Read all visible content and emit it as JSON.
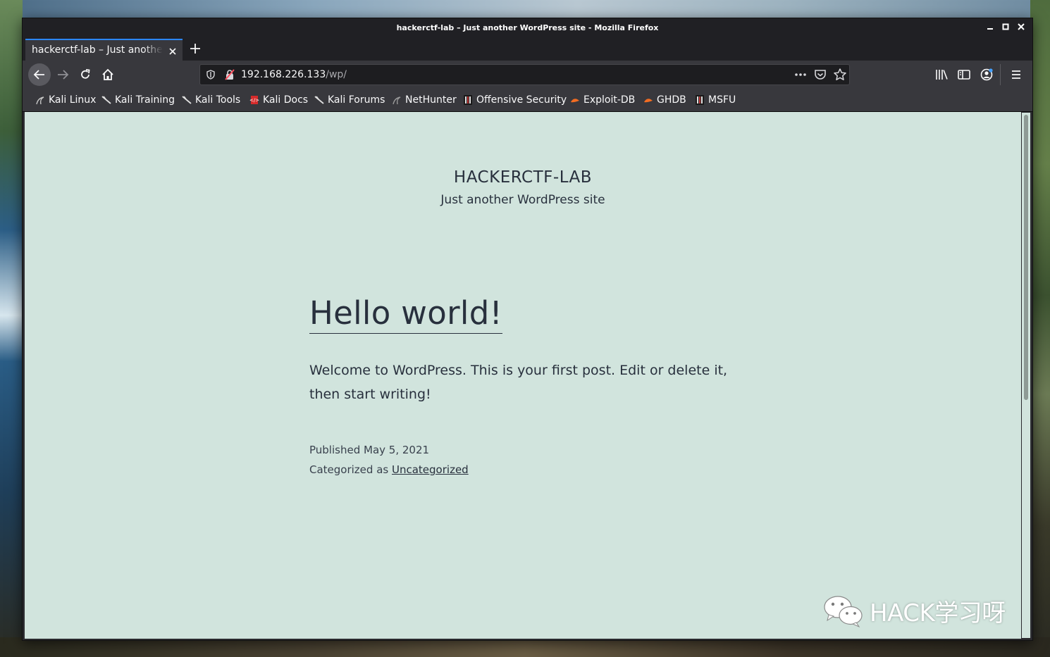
{
  "window": {
    "title": "hackerctf-lab – Just another WordPress site - Mozilla Firefox"
  },
  "tabs": [
    {
      "label": "hackerctf-lab – Just another WordPress site",
      "active": true
    }
  ],
  "navbar": {
    "url_host": "192.168.226.133",
    "url_path": "/wp/"
  },
  "bookmarks": [
    {
      "label": "Kali Linux",
      "icon": "kali-dragon-icon"
    },
    {
      "label": "Kali Training",
      "icon": "kali-dragon-icon"
    },
    {
      "label": "Kali Tools",
      "icon": "kali-dragon-icon"
    },
    {
      "label": "Kali Docs",
      "icon": "kali-docs-icon"
    },
    {
      "label": "Kali Forums",
      "icon": "kali-dragon-icon"
    },
    {
      "label": "NetHunter",
      "icon": "nethunter-icon"
    },
    {
      "label": "Offensive Security",
      "icon": "offsec-icon"
    },
    {
      "label": "Exploit-DB",
      "icon": "exploitdb-icon"
    },
    {
      "label": "GHDB",
      "icon": "exploitdb-icon"
    },
    {
      "label": "MSFU",
      "icon": "offsec-icon"
    }
  ],
  "page": {
    "site_title": "HACKERCTF-LAB",
    "site_description": "Just another WordPress site",
    "post_title": "Hello world!",
    "post_body": "Welcome to WordPress. This is your first post. Edit or delete it, then start writing!",
    "published_prefix": "Published",
    "published_date": "May 5, 2021",
    "categorized_prefix": "Categorized as",
    "category": "Uncategorized"
  },
  "watermark": {
    "text": "HACK学习呀",
    "icon": "wechat-icon"
  },
  "colors": {
    "page_background": "#d1e4dd",
    "text": "#28303d",
    "toolbar": "#38383d",
    "titlebar": "#202024",
    "tab_accent": "#2b86ff"
  }
}
